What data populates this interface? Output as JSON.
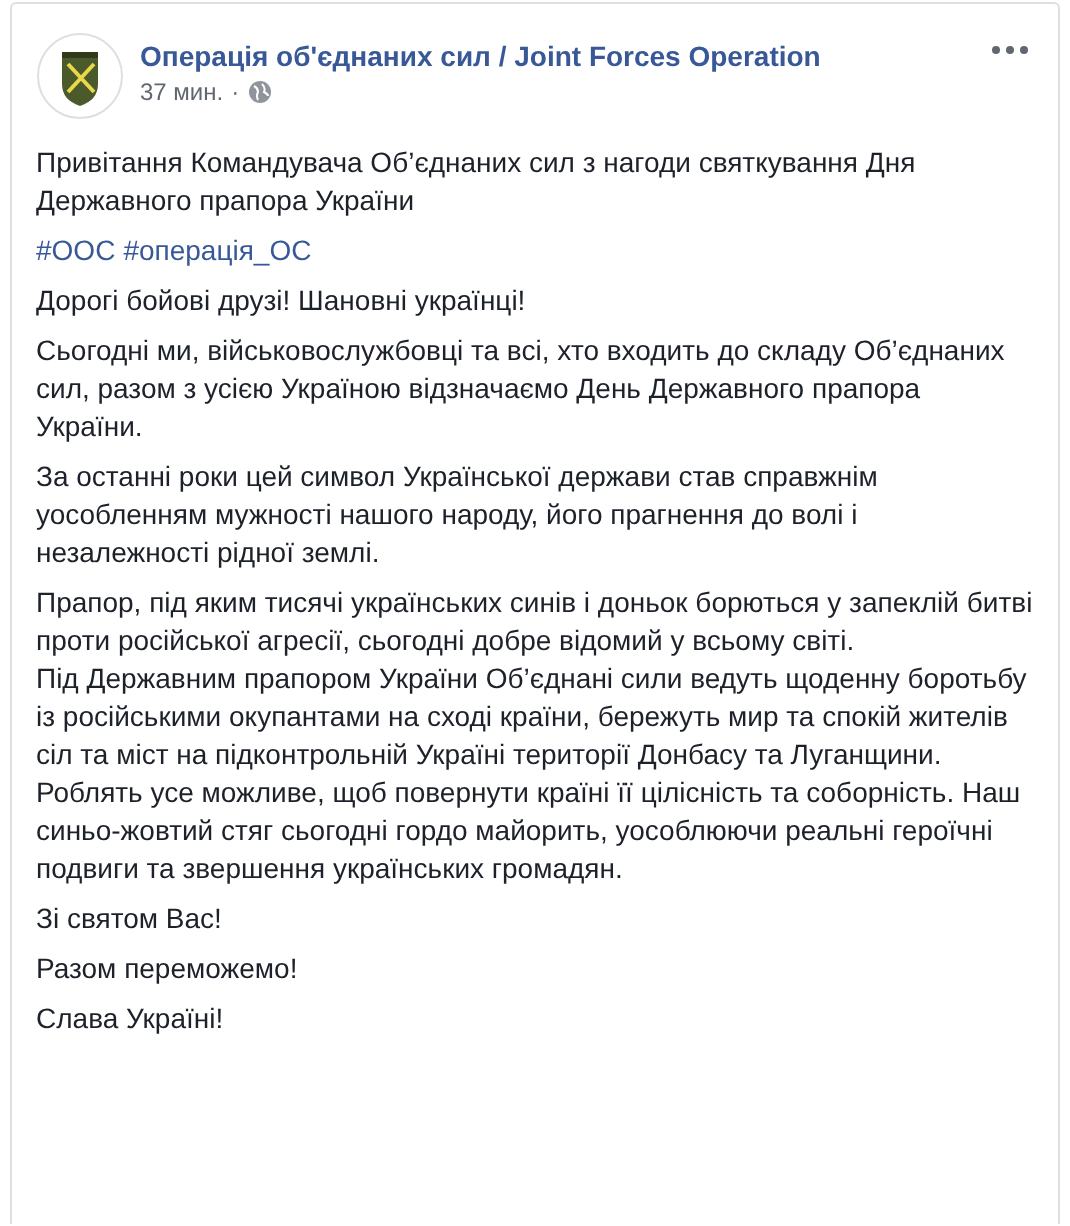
{
  "post": {
    "author": "Операція об'єднаних сил / Joint Forces Operation",
    "time": "37 мин.",
    "separator": "·",
    "paragraphs": [
      {
        "kind": "text",
        "lines": [
          "Привітання Командувача Об’єднаних сил з нагоди святкування Дня Державного прапора України"
        ]
      },
      {
        "kind": "hashtags",
        "tags": [
          "#ООС",
          "#операція_ОС"
        ]
      },
      {
        "kind": "text",
        "lines": [
          "Дорогі бойові друзі! Шановні українці!"
        ]
      },
      {
        "kind": "text",
        "lines": [
          "Сьогодні ми, військовослужбовці та всі, хто входить до складу Об’єднаних сил, разом з усією Україною відзначаємо День Державного прапора України."
        ]
      },
      {
        "kind": "text",
        "lines": [
          "За останні роки цей символ Української держави став справжнім уособленням мужності нашого народу, його прагнення до волі і незалежності рідної землі."
        ]
      },
      {
        "kind": "text",
        "lines": [
          "Прапор, під яким тисячі українських синів і доньок борються у запеклій битві проти російської агресії, сьогодні добре відомий у всьому світі.",
          "Під Державним прапором України Об’єднані сили ведуть щоденну боротьбу із російськими окупантами на сході країни, бережуть мир та спокій жителів сіл та міст на підконтрольній Україні території Донбасу та Луганщини. Роблять усе можливе, щоб повернути країні її цілісність та соборність. Наш синьо-жовтий стяг сьогодні гордо майорить, уособлюючи реальні героїчні подвиги та звершення українських громадян."
        ]
      },
      {
        "kind": "text",
        "lines": [
          "Зі святом Вас!"
        ]
      },
      {
        "kind": "text",
        "lines": [
          "Разом переможемо!"
        ]
      },
      {
        "kind": "text",
        "lines": [
          "Слава Україні!"
        ]
      }
    ]
  }
}
